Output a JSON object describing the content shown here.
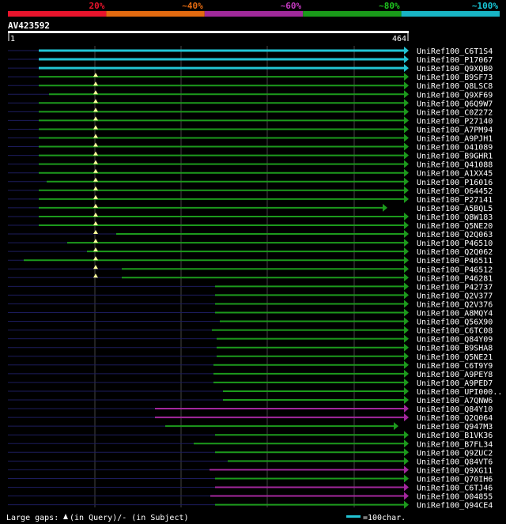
{
  "header": {
    "scale_labels": [
      "20%",
      "~40%",
      "~60%",
      "~80%",
      "~100%"
    ],
    "scale_colors": [
      "#e8142c",
      "#e36a10",
      "#a02a9a",
      "#1a9a1a",
      "#18b4c4"
    ],
    "query_id": "AV423592",
    "ruler_start": "1",
    "ruler_end": "464"
  },
  "colors": {
    "cyan": "#22c4d4",
    "green": "#1c9a1c",
    "magenta": "#a3279d",
    "dark_blue": "#1c1c5c",
    "gap_marker": "#ffff99",
    "grid": "#444444"
  },
  "hits": [
    {
      "id": "UniRef100_C6T1S4",
      "color": "cyan"
    },
    {
      "id": "UniRef100_P17067",
      "color": "cyan"
    },
    {
      "id": "UniRef100_Q9XQB0",
      "color": "cyan"
    },
    {
      "id": "UniRef100_B9SF73",
      "color": "green"
    },
    {
      "id": "UniRef100_Q8LSC8",
      "color": "green"
    },
    {
      "id": "UniRef100_Q9XF69",
      "color": "green"
    },
    {
      "id": "UniRef100_Q6Q9W7",
      "color": "green"
    },
    {
      "id": "UniRef100_C0Z272",
      "color": "green"
    },
    {
      "id": "UniRef100_P27140",
      "color": "green"
    },
    {
      "id": "UniRef100_A7PM94",
      "color": "green"
    },
    {
      "id": "UniRef100_A9PJH1",
      "color": "green"
    },
    {
      "id": "UniRef100_O41089",
      "color": "green"
    },
    {
      "id": "UniRef100_B9GHR1",
      "color": "green"
    },
    {
      "id": "UniRef100_Q41088",
      "color": "green"
    },
    {
      "id": "UniRef100_A1XX45",
      "color": "green"
    },
    {
      "id": "UniRef100_P16016",
      "color": "green"
    },
    {
      "id": "UniRef100_O64452",
      "color": "green"
    },
    {
      "id": "UniRef100_P27141",
      "color": "green"
    },
    {
      "id": "UniRef100_A5BQL5",
      "color": "green"
    },
    {
      "id": "UniRef100_Q8W183",
      "color": "green"
    },
    {
      "id": "UniRef100_Q5NE20",
      "color": "green"
    },
    {
      "id": "UniRef100_Q2Q063",
      "color": "green"
    },
    {
      "id": "UniRef100_P46510",
      "color": "green"
    },
    {
      "id": "UniRef100_Q2Q062",
      "color": "green"
    },
    {
      "id": "UniRef100_P46511",
      "color": "green"
    },
    {
      "id": "UniRef100_P46512",
      "color": "green"
    },
    {
      "id": "UniRef100_P46281",
      "color": "green"
    },
    {
      "id": "UniRef100_P42737",
      "color": "green"
    },
    {
      "id": "UniRef100_Q2V377",
      "color": "green"
    },
    {
      "id": "UniRef100_Q2V376",
      "color": "green"
    },
    {
      "id": "UniRef100_A8MQY4",
      "color": "green"
    },
    {
      "id": "UniRef100_Q56X90",
      "color": "green"
    },
    {
      "id": "UniRef100_C6TC08",
      "color": "green"
    },
    {
      "id": "UniRef100_Q84Y09",
      "color": "green"
    },
    {
      "id": "UniRef100_B9SHA8",
      "color": "green"
    },
    {
      "id": "UniRef100_Q5NE21",
      "color": "green"
    },
    {
      "id": "UniRef100_C6T9Y9",
      "color": "green"
    },
    {
      "id": "UniRef100_A9PEY8",
      "color": "green"
    },
    {
      "id": "UniRef100_A9PED7",
      "color": "green"
    },
    {
      "id": "UniRef100_UPI000..",
      "color": "green"
    },
    {
      "id": "UniRef100_A7QNW6",
      "color": "green"
    },
    {
      "id": "UniRef100_Q84Y10",
      "color": "magenta"
    },
    {
      "id": "UniRef100_Q2Q064",
      "color": "magenta"
    },
    {
      "id": "UniRef100_Q947M3",
      "color": "green"
    },
    {
      "id": "UniRef100_B1VK36",
      "color": "green"
    },
    {
      "id": "UniRef100_B7FL34",
      "color": "green"
    },
    {
      "id": "UniRef100_Q9ZUC2",
      "color": "green"
    },
    {
      "id": "UniRef100_Q84VT6",
      "color": "green"
    },
    {
      "id": "UniRef100_Q9XG11",
      "color": "magenta"
    },
    {
      "id": "UniRef100_Q70IH6",
      "color": "green"
    },
    {
      "id": "UniRef100_C6TJ46",
      "color": "magenta"
    },
    {
      "id": "UniRef100_O04855",
      "color": "magenta"
    },
    {
      "id": "UniRef100_Q94CE4",
      "color": "green"
    }
  ],
  "legend": {
    "gaps_text": "Large gaps: ",
    "in_query": "(in Query)/- (in Subject)",
    "scale_text": "=100char."
  }
}
